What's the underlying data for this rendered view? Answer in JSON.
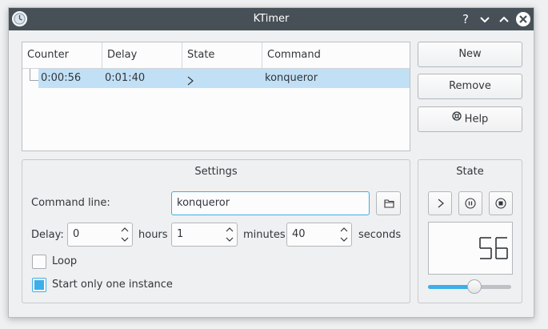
{
  "window": {
    "title": "KTimer"
  },
  "titlebar": {
    "help_glyph": "?",
    "minimize_glyph": "⌄",
    "maximize_glyph": "⌃",
    "close_glyph": "✕"
  },
  "list": {
    "columns": [
      "Counter",
      "Delay",
      "State",
      "Command"
    ],
    "rows": [
      {
        "counter": "0:00:56",
        "delay": "0:01:40",
        "state_icon": "play-icon",
        "command": "konqueror"
      }
    ]
  },
  "buttons": {
    "new": "New",
    "remove": "Remove",
    "help": "Help"
  },
  "settings": {
    "title": "Settings",
    "command_label": "Command line:",
    "command_value": "konqueror",
    "delay_label": "Delay:",
    "hours_value": "0",
    "hours_unit": "hours",
    "minutes_value": "1",
    "minutes_unit": "minutes",
    "seconds_value": "40",
    "seconds_unit": "seconds",
    "loop_label": "Loop",
    "loop_checked": false,
    "one_instance_label": "Start only one instance",
    "one_instance_checked": true
  },
  "state": {
    "title": "State",
    "lcd_value": "56",
    "slider_fraction": 0.56
  },
  "colors": {
    "accent": "#3daee9",
    "titlebar": "#475057",
    "selection": "#c2e0f5"
  }
}
